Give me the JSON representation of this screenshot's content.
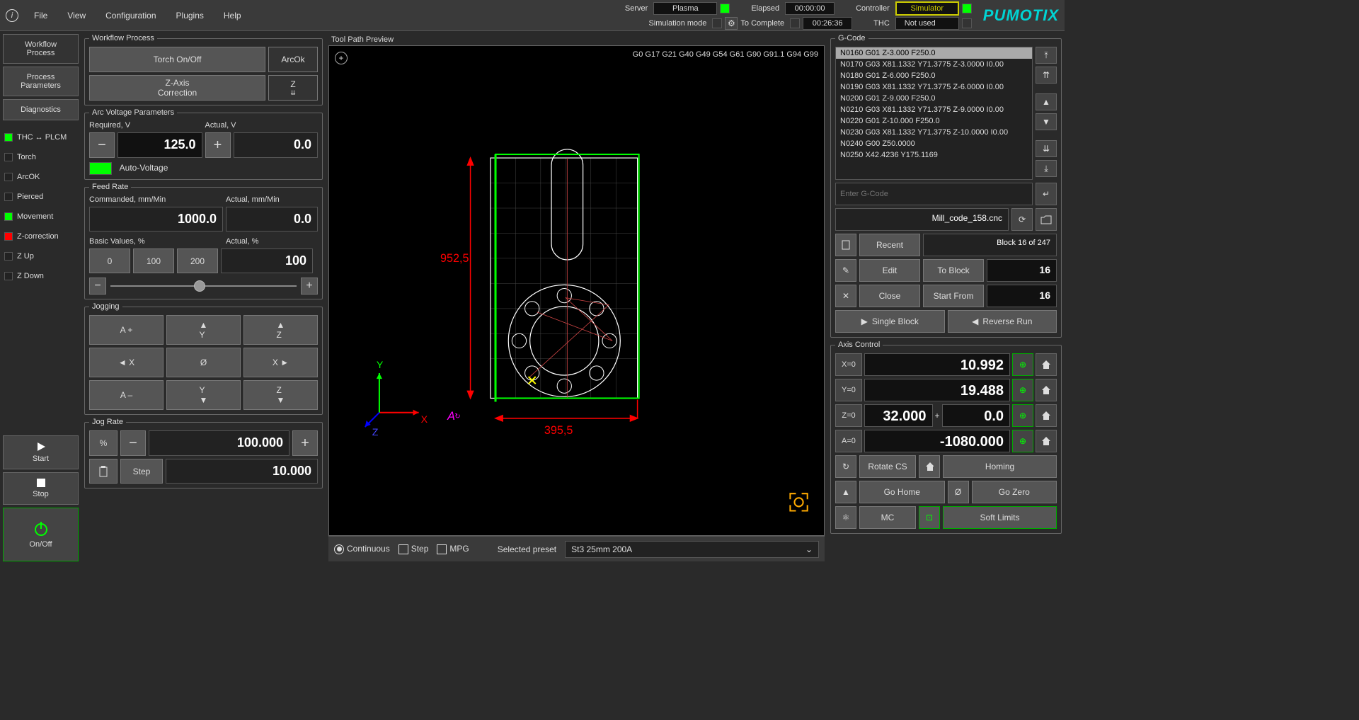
{
  "menu": {
    "file": "File",
    "view": "View",
    "config": "Configuration",
    "plugins": "Plugins",
    "help": "Help"
  },
  "top": {
    "server": "Server",
    "server_val": "Plasma",
    "elapsed": "Elapsed",
    "elapsed_val": "00:00:00",
    "controller": "Controller",
    "controller_val": "Simulator",
    "simmode": "Simulation mode",
    "tocomplete": "To Complete",
    "tocomplete_val": "00:26:36",
    "thc": "THC",
    "thc_val": "Not used"
  },
  "logo": "PUMOTIX",
  "sidebar": {
    "workflow": "Workflow\nProcess",
    "params": "Process\nParameters",
    "diag": "Diagnostics",
    "thcplcm": "THC ↔ PLCM",
    "torch": "Torch",
    "arcok": "ArcOK",
    "pierced": "Pierced",
    "movement": "Movement",
    "zcorr": "Z-correction",
    "zup": "Z Up",
    "zdown": "Z Down",
    "start": "Start",
    "stop": "Stop",
    "onoff": "On/Off"
  },
  "workflow": {
    "title": "Workflow Process",
    "torchonoff": "Torch On/Off",
    "arcok": "ArcOk",
    "zaxiscorr": "Z-Axis\nCorrection",
    "z": "Z"
  },
  "arc": {
    "title": "Arc Voltage Parameters",
    "required": "Required, V",
    "actual": "Actual, V",
    "required_val": "125.0",
    "actual_val": "0.0",
    "auto": "Auto-Voltage"
  },
  "feed": {
    "title": "Feed Rate",
    "cmd": "Commanded, mm/Min",
    "actual": "Actual, mm/Min",
    "cmd_val": "1000.0",
    "actual_val": "0.0",
    "basic": "Basic Values, %",
    "actualp": "Actual, %",
    "b0": "0",
    "b100": "100",
    "b200": "200",
    "actualp_val": "100"
  },
  "jog": {
    "title": "Jogging",
    "ap": "A +",
    "yp": "Y",
    "zp": "Z",
    "xm": "X",
    "origin": "Ø",
    "xp": "X",
    "am": "A –",
    "ym": "Y",
    "zm": "Z"
  },
  "jograte": {
    "title": "Jog Rate",
    "pct": "%",
    "val": "100.000",
    "step": "Step",
    "step_val": "10.000"
  },
  "preview": {
    "title": "Tool Path Preview",
    "codes": "G0 G17 G21 G40 G49 G54 G61 G90 G91.1 G94 G99",
    "dimh": "952,5",
    "dimw": "395,5",
    "axisY": "Y",
    "axisX": "X",
    "axisZ": "Z",
    "axisA": "A"
  },
  "gcode": {
    "title": "G-Code",
    "lines": [
      "N0160 G01 Z-3.000 F250.0",
      "N0170 G03 X81.1332 Y71.3775 Z-3.0000 I0.00",
      "N0180 G01 Z-6.000 F250.0",
      "N0190 G03 X81.1332 Y71.3775 Z-6.0000 I0.00",
      "N0200 G01 Z-9.000 F250.0",
      "N0210 G03 X81.1332 Y71.3775 Z-9.0000 I0.00",
      "N0220 G01 Z-10.000 F250.0",
      "N0230 G03 X81.1332 Y71.3775 Z-10.0000 I0.00",
      "N0240 G00 Z50.0000",
      "N0250 X42.4236 Y175.1169"
    ],
    "input_ph": "Enter G-Code",
    "file": "Mill_code_158.cnc",
    "recent": "Recent",
    "block": "Block 16 of 247",
    "edit": "Edit",
    "toblock": "To Block",
    "n1": "16",
    "close": "Close",
    "startfrom": "Start From",
    "n2": "16",
    "singleblock": "Single Block",
    "reverse": "Reverse Run"
  },
  "axis": {
    "title": "Axis Control",
    "x": "X=0",
    "xval": "10.992",
    "y": "Y=0",
    "yval": "19.488",
    "z": "Z=0",
    "zval1": "32.000",
    "zval2": "0.0",
    "a": "A=0",
    "aval": "-1080.000",
    "rotate": "Rotate CS",
    "homing": "Homing",
    "gohome": "Go Home",
    "gozero": "Go Zero",
    "mc": "MC",
    "softlimits": "Soft Limits"
  },
  "bottom": {
    "continuous": "Continuous",
    "step": "Step",
    "mpg": "MPG",
    "preset": "Selected preset",
    "preset_val": "St3 25mm 200A"
  }
}
